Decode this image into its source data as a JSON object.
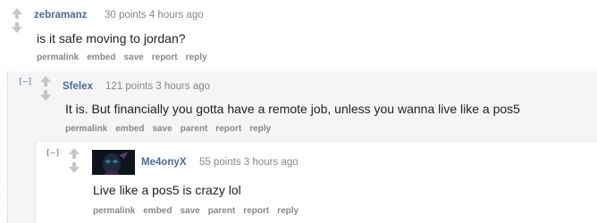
{
  "comments": [
    {
      "author": "zebramanz",
      "points": "30 points",
      "time": "4 hours ago",
      "body": "is it safe moving to jordan?",
      "buttons": [
        "permalink",
        "embed",
        "save",
        "report",
        "reply"
      ]
    },
    {
      "collapse": "[–]",
      "author": "Sfelex",
      "points": "121 points",
      "time": "3 hours ago",
      "body": "It is. But financially you gotta have a remote job, unless you wanna live like a pos5",
      "buttons": [
        "permalink",
        "embed",
        "save",
        "parent",
        "report",
        "reply"
      ]
    },
    {
      "collapse": "[–]",
      "author": "Me4onyX",
      "points": "55 points",
      "time": "3 hours ago",
      "body": "Live like a pos5 is crazy lol",
      "buttons": [
        "permalink",
        "embed",
        "save",
        "parent",
        "report",
        "reply"
      ]
    }
  ],
  "colors": {
    "author": "#4a6a9a",
    "meta": "#888888",
    "arrow": "#c6c6c6",
    "child_bg": "#f5f5f5"
  },
  "icons": {
    "upvote": "up-arrow-icon",
    "downvote": "down-arrow-icon"
  }
}
